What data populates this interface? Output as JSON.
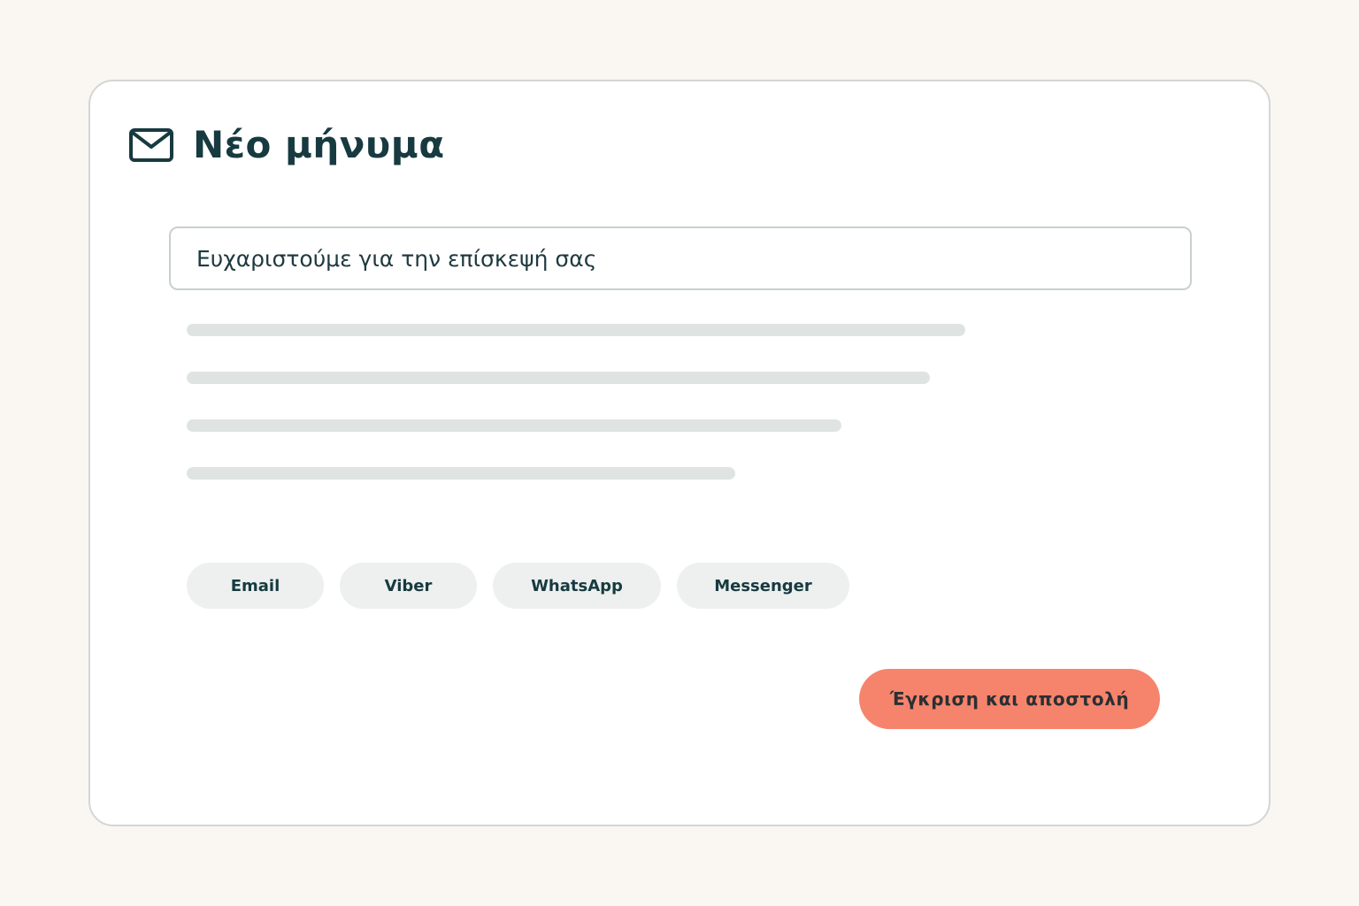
{
  "compose": {
    "title": "Νέο μήνυμα",
    "title_icon": "mail-icon",
    "subject_value": "Ευχαριστούμε για την επίσκεψή σας",
    "channels": [
      {
        "label": "Email"
      },
      {
        "label": "Viber"
      },
      {
        "label": "WhatsApp"
      },
      {
        "label": "Messenger"
      }
    ],
    "approve_label": "Έγκριση και αποστολή"
  },
  "colors": {
    "background": "#faf7f2",
    "card": "#ffffff",
    "text_primary": "#173a40",
    "accent": "#f6846c",
    "chip_bg": "#edf0ef",
    "skeleton": "#dfe4e3",
    "border": "#d3d6d6"
  }
}
